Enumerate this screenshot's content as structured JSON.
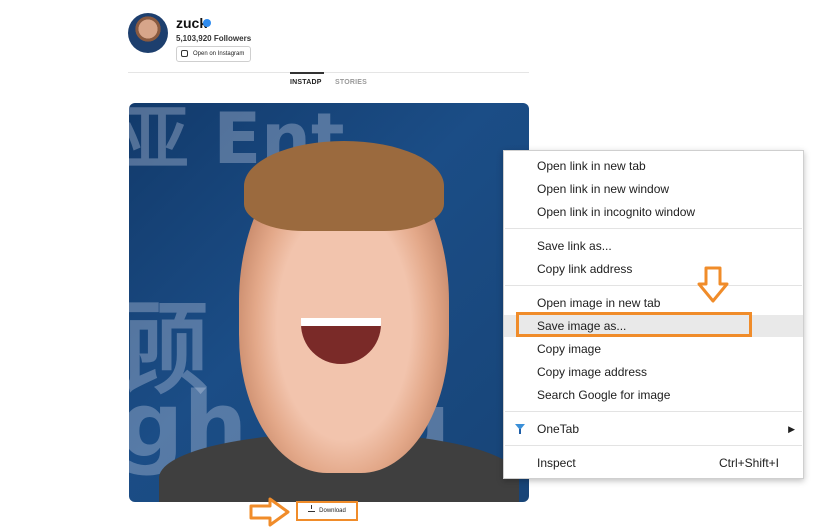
{
  "profile": {
    "username": "zuck",
    "followers": "5,103,920 Followers",
    "open_button": "Open on Instagram"
  },
  "tabs": [
    {
      "label": "INSTADP",
      "active": true
    },
    {
      "label": "STORIES",
      "active": false
    }
  ],
  "download": {
    "label": "Download"
  },
  "context_menu": {
    "groups": [
      [
        "Open link in new tab",
        "Open link in new window",
        "Open link in incognito window"
      ],
      [
        "Save link as...",
        "Copy link address"
      ],
      [
        "Open image in new tab",
        "Save image as...",
        "Copy image",
        "Copy image address",
        "Search Google for image"
      ],
      [
        "OneTab"
      ],
      [
        "Inspect"
      ]
    ],
    "highlighted": "Save image as...",
    "inspect_shortcut": "Ctrl+Shift+I"
  },
  "colors": {
    "accent_orange": "#f08c2a",
    "verified_blue": "#2f8cf0",
    "menu_highlight": "#e9e9e9"
  }
}
